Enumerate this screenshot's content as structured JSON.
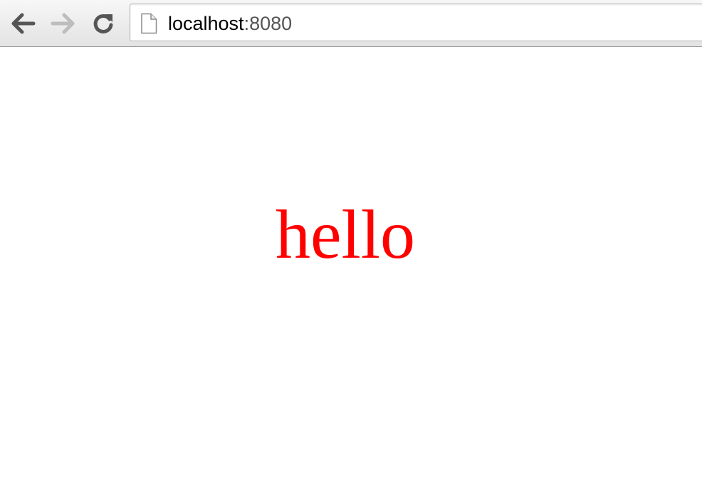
{
  "toolbar": {
    "back_icon": "arrow-left-icon",
    "forward_icon": "arrow-right-icon",
    "reload_icon": "reload-icon",
    "forward_enabled": false
  },
  "address_bar": {
    "page_icon": "document-icon",
    "host": "localhost",
    "port": ":8080"
  },
  "page": {
    "text": "hello",
    "text_color": "#ff0000"
  }
}
